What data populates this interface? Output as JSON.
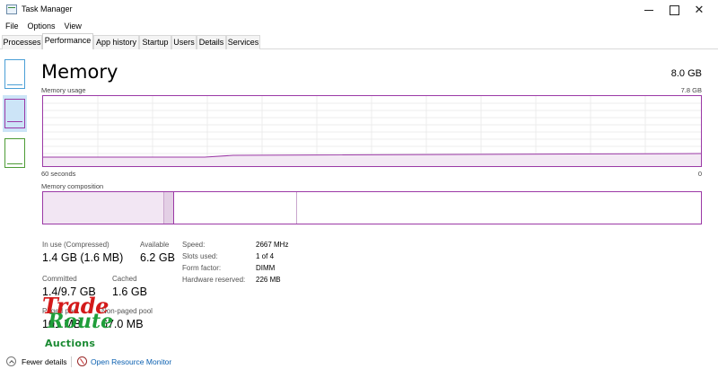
{
  "window": {
    "title": "Task Manager",
    "minimize": "",
    "maximize": "",
    "close": "✕"
  },
  "menu": [
    "File",
    "Options",
    "View"
  ],
  "tabs": [
    "Processes",
    "Performance",
    "App history",
    "Startup",
    "Users",
    "Details",
    "Services"
  ],
  "active_tab": "Performance",
  "sidebar": {
    "selected": "memory",
    "items": [
      "cpu",
      "memory",
      "disk"
    ]
  },
  "panel": {
    "title": "Memory",
    "total": "8.0 GB",
    "usage_label": "Memory usage",
    "usage_max": "7.8 GB",
    "axis_left": "60 seconds",
    "axis_right": "0",
    "composition_label": "Memory composition"
  },
  "stats": {
    "in_use": {
      "label": "In use (Compressed)",
      "value": "1.4 GB (1.6 MB)"
    },
    "available": {
      "label": "Available",
      "value": "6.2 GB"
    },
    "committed": {
      "label": "Committed",
      "value": "1.4/9.7 GB"
    },
    "cached": {
      "label": "Cached",
      "value": "1.6 GB"
    },
    "paged_pool": {
      "label": "Paged pool",
      "value": "101 MB"
    },
    "non_paged_pool": {
      "label": "Non-paged pool",
      "value": "67.0 MB"
    }
  },
  "details": [
    {
      "key": "Speed:",
      "value": "2667 MHz"
    },
    {
      "key": "Slots used:",
      "value": "1 of 4"
    },
    {
      "key": "Form factor:",
      "value": "DIMM"
    },
    {
      "key": "Hardware reserved:",
      "value": "226 MB"
    }
  ],
  "watermark": {
    "line1": "Trade",
    "line2": "Route",
    "line3": "Auctions"
  },
  "footer": {
    "fewer_details": "Fewer details",
    "open_resource_monitor": "Open Resource Monitor"
  },
  "colors": {
    "memory_accent": "#9b39a6",
    "cpu_accent": "#4a9fd6",
    "disk_accent": "#4d9b35",
    "link": "#0a5fb0"
  },
  "icons": {
    "app": "task-manager-icon",
    "fewer": "chevron-up-circle-icon",
    "resource_monitor": "resource-monitor-icon"
  }
}
